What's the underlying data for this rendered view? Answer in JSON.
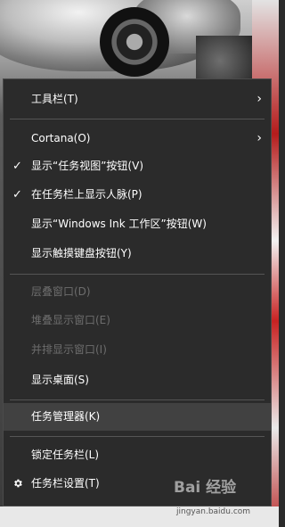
{
  "menu": {
    "items": [
      {
        "label": "工具栏(T)",
        "submenu": true
      },
      {
        "label": "Cortana(O)",
        "submenu": true
      },
      {
        "label": "显示“任务视图”按钮(V)",
        "checked": true
      },
      {
        "label": "在任务栏上显示人脉(P)",
        "checked": true
      },
      {
        "label": "显示“Windows Ink 工作区”按钮(W)"
      },
      {
        "label": "显示触摸键盘按钮(Y)"
      },
      {
        "label": "层叠窗口(D)",
        "disabled": true
      },
      {
        "label": "堆叠显示窗口(E)",
        "disabled": true
      },
      {
        "label": "并排显示窗口(I)",
        "disabled": true
      },
      {
        "label": "显示桌面(S)"
      },
      {
        "label": "任务管理器(K)",
        "highlighted": true
      },
      {
        "label": "锁定任务栏(L)"
      },
      {
        "label": "任务栏设置(T)",
        "icon": "gear-icon"
      }
    ],
    "check_glyph": "✓",
    "arrow_glyph": "›"
  },
  "watermark": {
    "logo": "Bai 经验",
    "url": "jingyan.baidu.com"
  },
  "colors": {
    "menu_bg": "#2b2b2b",
    "hover_bg": "#414141",
    "text": "#ffffff",
    "disabled_text": "#6d6d6d",
    "separator": "#555555"
  }
}
